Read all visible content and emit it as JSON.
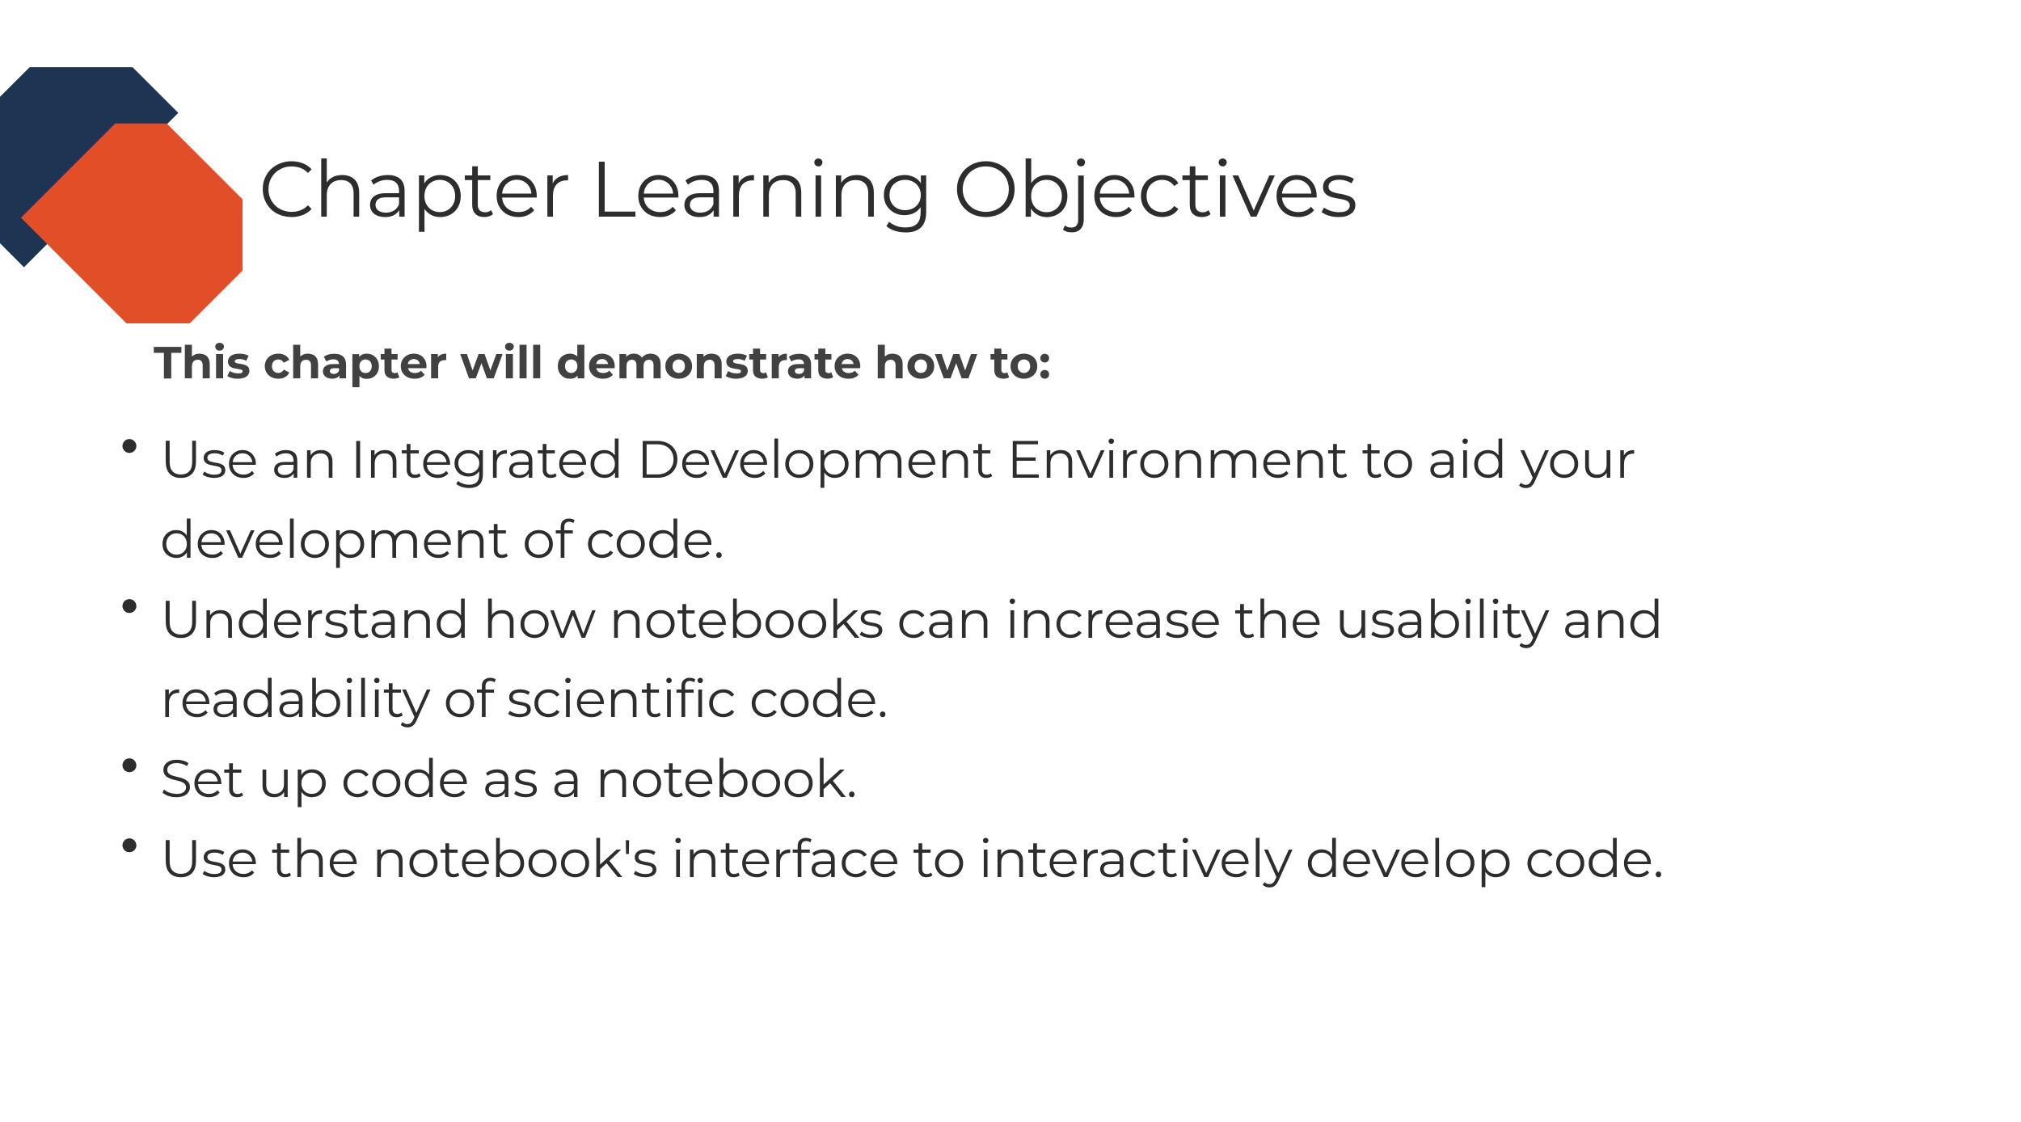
{
  "title": "Chapter Learning Objectives",
  "subtitle": "This chapter will demonstrate how to:",
  "bullets": [
    "Use an Integrated Development Environment to aid your development of code.",
    "Understand how notebooks can increase the usability and readability of scientific code.",
    "Set up code as a notebook.",
    "Use the notebook's interface to interactively develop code."
  ],
  "colors": {
    "navy": "#1d3453",
    "orange": "#e14e27"
  }
}
